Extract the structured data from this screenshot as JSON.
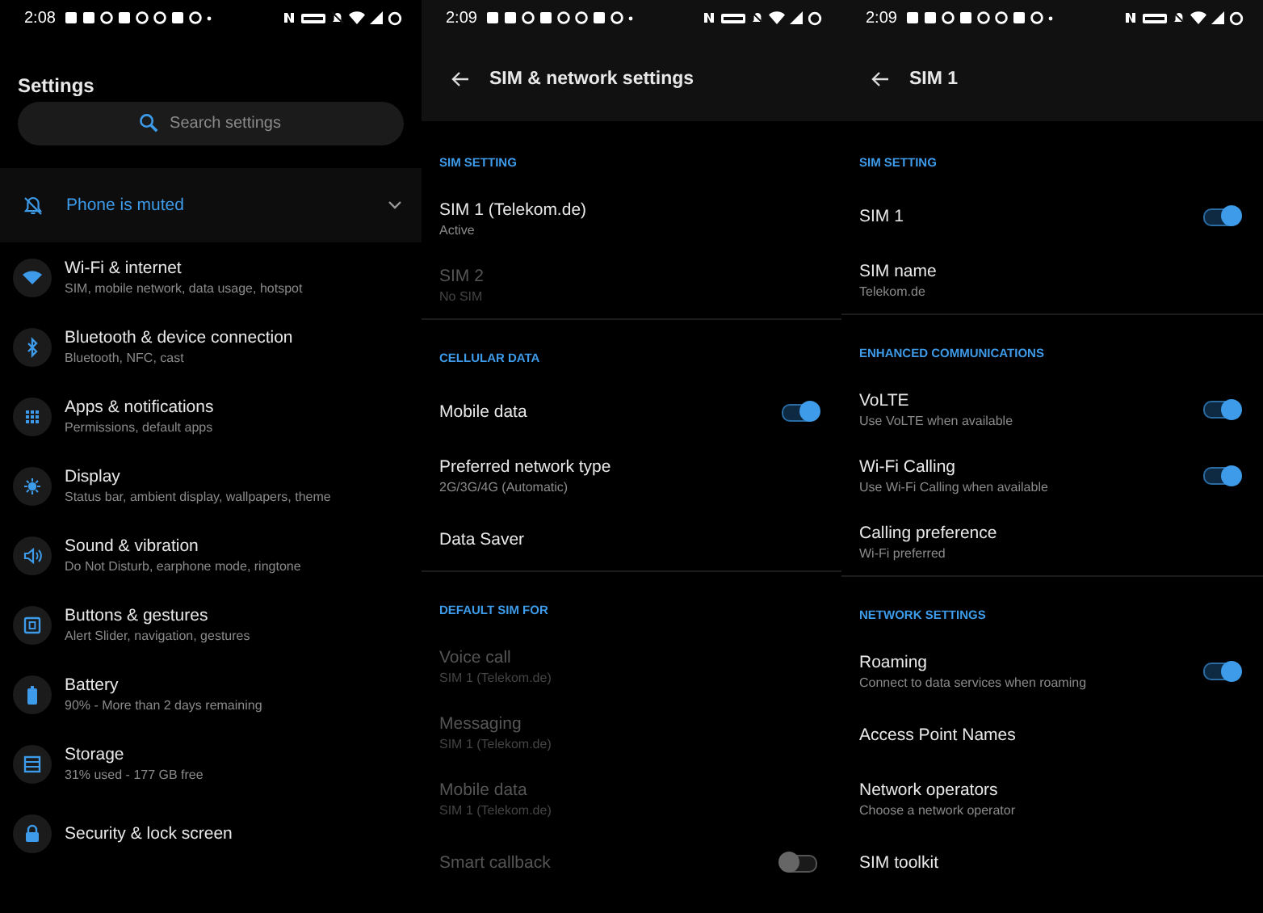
{
  "screens": [
    {
      "kind": "home",
      "status_bar": {
        "time": "2:08"
      },
      "title": "Settings",
      "search": {
        "placeholder": "Search settings"
      },
      "banner": {
        "text": "Phone is muted",
        "expanded": false
      },
      "items": [
        {
          "title": "Wi-Fi & internet",
          "subtitle": "SIM, mobile network, data usage, hotspot"
        },
        {
          "title": "Bluetooth & device connection",
          "subtitle": "Bluetooth, NFC, cast"
        },
        {
          "title": "Apps & notifications",
          "subtitle": "Permissions, default apps"
        },
        {
          "title": "Display",
          "subtitle": "Status bar, ambient display, wallpapers, theme"
        },
        {
          "title": "Sound & vibration",
          "subtitle": "Do Not Disturb, earphone mode, ringtone"
        },
        {
          "title": "Buttons & gestures",
          "subtitle": "Alert Slider, navigation, gestures"
        },
        {
          "title": "Battery",
          "subtitle": "90% - More than 2 days remaining"
        },
        {
          "title": "Storage",
          "subtitle": "31% used - 177 GB free"
        },
        {
          "title": "Security & lock screen"
        }
      ]
    },
    {
      "kind": "detail",
      "status_bar": {
        "time": "2:09"
      },
      "title": "SIM & network settings",
      "sections": [
        {
          "header": "SIM SETTING",
          "items": [
            {
              "title": "SIM 1  (Telekom.de)",
              "subtitle": "Active",
              "disabled": false
            },
            {
              "title": "SIM 2",
              "subtitle": "No SIM",
              "disabled": true
            }
          ]
        },
        {
          "header": "CELLULAR DATA",
          "items": [
            {
              "title": "Mobile data",
              "disabled": false,
              "on": true
            },
            {
              "title": "Preferred network type",
              "subtitle": "2G/3G/4G (Automatic)",
              "disabled": false
            },
            {
              "title": "Data Saver",
              "disabled": false
            }
          ]
        },
        {
          "header": "DEFAULT SIM FOR",
          "items": [
            {
              "title": "Voice call",
              "subtitle": "SIM 1  (Telekom.de)",
              "disabled": true
            },
            {
              "title": "Messaging",
              "subtitle": "SIM 1  (Telekom.de)",
              "disabled": true
            },
            {
              "title": "Mobile data",
              "subtitle": "SIM 1  (Telekom.de)",
              "disabled": true
            },
            {
              "title": "Smart callback",
              "disabled": true,
              "on": false
            }
          ]
        }
      ]
    },
    {
      "kind": "detail",
      "status_bar": {
        "time": "2:09"
      },
      "title": "SIM 1",
      "sections": [
        {
          "header": "SIM SETTING",
          "items": [
            {
              "title": "SIM 1",
              "disabled": false,
              "on": true
            },
            {
              "title": "SIM name",
              "subtitle": "Telekom.de",
              "disabled": false
            }
          ]
        },
        {
          "header": "ENHANCED COMMUNICATIONS",
          "items": [
            {
              "title": "VoLTE",
              "subtitle": "Use VoLTE when available",
              "disabled": false,
              "on": true
            },
            {
              "title": "Wi-Fi Calling",
              "subtitle": "Use Wi-Fi Calling when available",
              "disabled": false,
              "on": true
            },
            {
              "title": "Calling preference",
              "subtitle": "Wi-Fi preferred",
              "disabled": false
            }
          ]
        },
        {
          "header": "NETWORK SETTINGS",
          "items": [
            {
              "title": "Roaming",
              "subtitle": "Connect to data services when roaming",
              "disabled": false,
              "on": true
            },
            {
              "title": "Access Point Names",
              "disabled": false
            },
            {
              "title": "Network operators",
              "subtitle": "Choose a network operator",
              "disabled": false
            },
            {
              "title": "SIM toolkit",
              "disabled": false
            }
          ]
        }
      ]
    }
  ]
}
